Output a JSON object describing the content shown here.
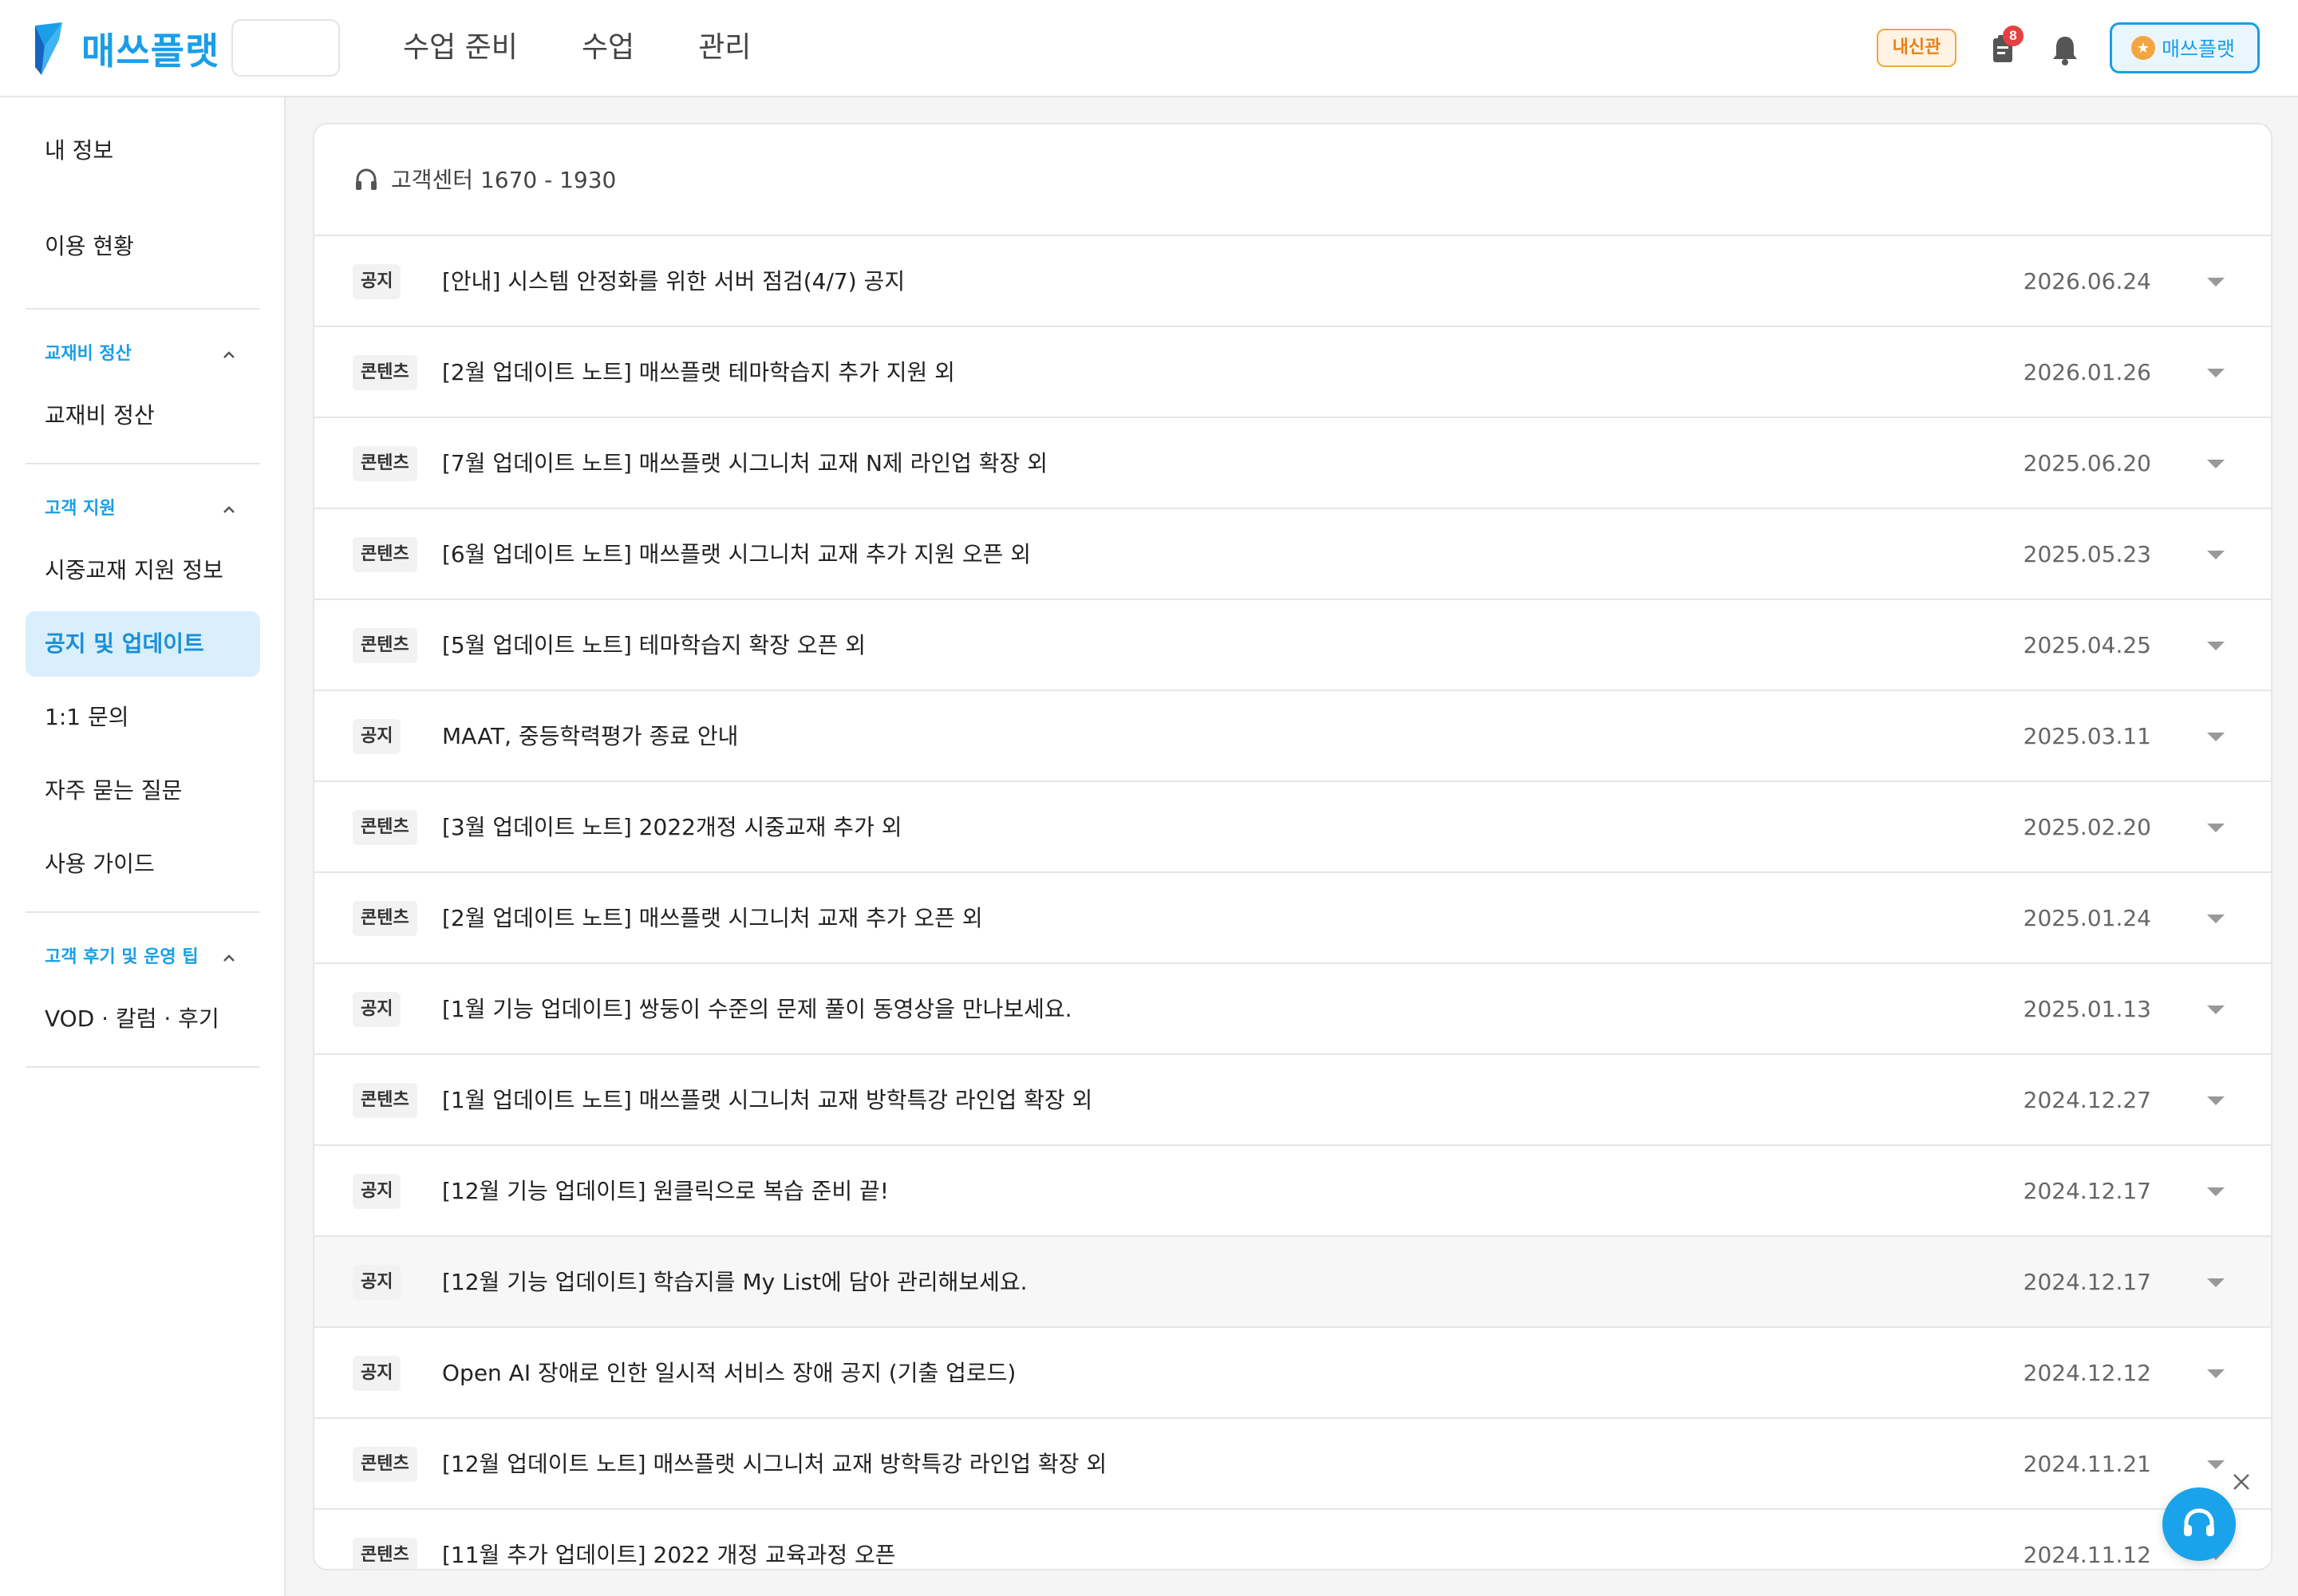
{
  "header": {
    "logo_text": "매쓰플랫",
    "nav": [
      "수업 준비",
      "수업",
      "관리"
    ],
    "badge": "내신관",
    "notification_count": "8",
    "account_label": "매쓰플랫",
    "brand_color": "#1a9ee8"
  },
  "sidebar": {
    "my_info": "내 정보",
    "usage": "이용 현황",
    "section_textbook": "교재비 정산",
    "textbook_item": "교재비 정산",
    "section_support": "고객 지원",
    "support_items": [
      "시중교재 지원 정보",
      "공지 및 업데이트",
      "1:1 문의",
      "자주 묻는 질문",
      "사용 가이드"
    ],
    "active_item": "공지 및 업데이트",
    "section_reviews": "고객 후기 및 운영 팁",
    "reviews_item": "VOD · 칼럼 · 후기"
  },
  "main": {
    "support_phone": "고객센터 1670 - 1930",
    "rows": [
      {
        "tag": "공지",
        "title": "[안내] 시스템 안정화를 위한 서버 점검(4/7) 공지",
        "date": "2026.06.24"
      },
      {
        "tag": "콘텐츠",
        "title": "[2월 업데이트 노트] 매쓰플랫 테마학습지 추가 지원 외",
        "date": "2026.01.26"
      },
      {
        "tag": "콘텐츠",
        "title": "[7월 업데이트 노트] 매쓰플랫 시그니처 교재 N제 라인업 확장 외",
        "date": "2025.06.20"
      },
      {
        "tag": "콘텐츠",
        "title": "[6월 업데이트 노트] 매쓰플랫 시그니처 교재 추가 지원 오픈 외",
        "date": "2025.05.23"
      },
      {
        "tag": "콘텐츠",
        "title": "[5월 업데이트 노트] 테마학습지 확장 오픈 외",
        "date": "2025.04.25"
      },
      {
        "tag": "공지",
        "title": "MAAT, 중등학력평가 종료 안내",
        "date": "2025.03.11"
      },
      {
        "tag": "콘텐츠",
        "title": "[3월 업데이트 노트] 2022개정 시중교재 추가 외",
        "date": "2025.02.20"
      },
      {
        "tag": "콘텐츠",
        "title": "[2월 업데이트 노트] 매쓰플랫 시그니처 교재 추가 오픈 외",
        "date": "2025.01.24"
      },
      {
        "tag": "공지",
        "title": "[1월 기능 업데이트] 쌍둥이 수준의 문제 풀이 동영상을 만나보세요.",
        "date": "2025.01.13"
      },
      {
        "tag": "콘텐츠",
        "title": "[1월 업데이트 노트] 매쓰플랫 시그니처 교재 방학특강 라인업 확장 외",
        "date": "2024.12.27"
      },
      {
        "tag": "공지",
        "title": "[12월 기능 업데이트] 원클릭으로 복습 준비 끝!",
        "date": "2024.12.17"
      },
      {
        "tag": "공지",
        "title": "[12월 기능 업데이트] 학습지를 My List에 담아 관리해보세요.",
        "date": "2024.12.17"
      },
      {
        "tag": "공지",
        "title": "Open AI 장애로 인한 일시적 서비스 장애 공지 (기출 업로드)",
        "date": "2024.12.12"
      },
      {
        "tag": "콘텐츠",
        "title": "[12월 업데이트 노트] 매쓰플랫 시그니처 교재 방학특강 라인업 확장 외",
        "date": "2024.11.21"
      },
      {
        "tag": "콘텐츠",
        "title": "[11월 추가 업데이트] 2022 개정 교육과정 오픈",
        "date": "2024.11.12"
      }
    ]
  },
  "icons": {
    "logo": "mathflat-logo-icon",
    "clipboard": "clipboard-icon",
    "bell": "bell-icon",
    "headset": "headset-icon",
    "caret": "caret-down-icon",
    "close": "close-icon",
    "help": "help-chat-icon"
  }
}
